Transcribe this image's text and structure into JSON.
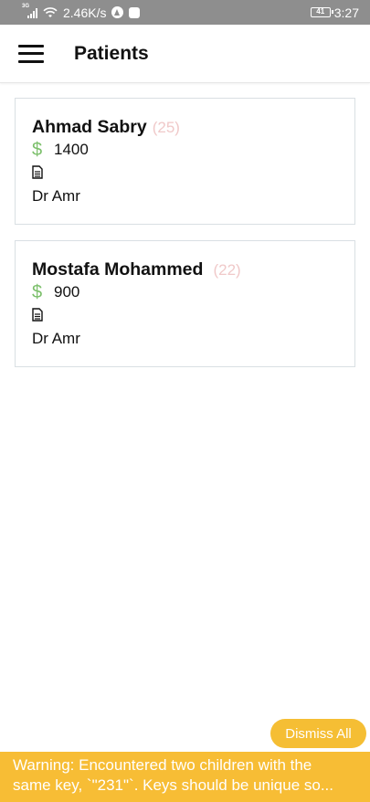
{
  "status_bar": {
    "network_type": "3G",
    "speed": "2.46K/s",
    "battery": "41",
    "time": "3:27"
  },
  "app_bar": {
    "title": "Patients"
  },
  "patients": [
    {
      "name": "Ahmad Sabry",
      "age": "(25)",
      "amount": "1400",
      "doctor": "Dr Amr"
    },
    {
      "name": "Mostafa Mohammed",
      "age": "(22)",
      "amount": "900",
      "doctor": "Dr Amr"
    }
  ],
  "dollar_symbol": "$",
  "dismiss_label": "Dismiss All",
  "warning": {
    "line1": "Warning: Encountered two children with the",
    "line2": "same key, `\"231\"`. Keys should be unique so..."
  },
  "colors": {
    "status_bar": "#8e8e8e",
    "age_text": "#f0c9c9",
    "dollar_green": "#7bbf6a",
    "warning_yellow": "#f7bd35"
  },
  "icons": [
    "menu-icon",
    "dollar-icon",
    "document-icon",
    "wifi-icon",
    "signal-icon",
    "battery-icon"
  ]
}
